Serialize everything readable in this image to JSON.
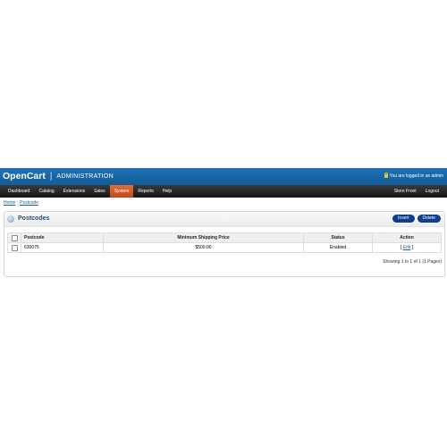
{
  "header": {
    "logo": "OpenCart",
    "logo_divider": "|",
    "logo_subtitle": "ADMINISTRATION",
    "logged_in_text": "You are logged in as admin"
  },
  "nav": {
    "left": [
      "Dashboard",
      "Catalog",
      "Extensions",
      "Sales",
      "System",
      "Reports",
      "Help"
    ],
    "active": "System",
    "right": [
      "Store Front",
      "Logout"
    ]
  },
  "breadcrumb": {
    "items": [
      "Home",
      "Postcode"
    ],
    "separator": "::"
  },
  "panel": {
    "title": "Postcodes",
    "insert_label": "Insert",
    "delete_label": "Delete"
  },
  "table": {
    "columns": [
      "Postcode",
      "Minimum Shipping Price",
      "Status",
      "Action"
    ],
    "rows": [
      {
        "postcode": "630075",
        "min_price": "$500.00",
        "status": "Enabled",
        "action_prefix": "[",
        "action": "Edit",
        "action_suffix": "]"
      }
    ]
  },
  "pagination": {
    "text": "Showing 1 to 1 of 1 (1 Pages)"
  },
  "colors": {
    "header_blue": "#1a69ab",
    "nav_dark": "#222222",
    "nav_active": "#d65a22",
    "button": "#0f3f8a",
    "link": "#1d5c9a"
  }
}
